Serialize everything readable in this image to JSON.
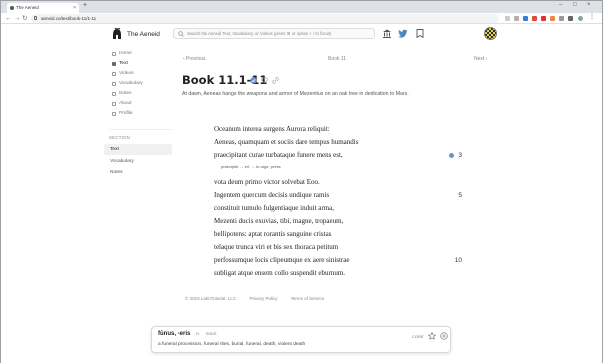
{
  "browser": {
    "tab_title": "The Aeneid",
    "tab_close": "×",
    "new_tab": "+",
    "window_controls": [
      "–",
      "□",
      "×"
    ],
    "back": "←",
    "forward": "→",
    "reload": "↻",
    "url": "aeneid.co/text/book-11/1-11"
  },
  "site": {
    "brand": "The Aeneid",
    "search_placeholder": "Search the Aeneid Text, Vocabulary, or Videos (press ⌘ or option + / to focus)"
  },
  "sidebar": {
    "items": [
      {
        "label": "Home",
        "icon": "home-icon"
      },
      {
        "label": "Text",
        "icon": "book-icon",
        "active": true
      },
      {
        "label": "Videos",
        "icon": "video-icon"
      },
      {
        "label": "Vocabulary",
        "icon": "list-icon"
      },
      {
        "label": "Notes",
        "icon": "note-icon"
      },
      {
        "label": "About",
        "icon": "info-icon"
      },
      {
        "label": "Profile",
        "icon": "user-icon"
      }
    ],
    "section_label": "SECTION",
    "section_items": [
      {
        "label": "Text",
        "active": true
      },
      {
        "label": "Vocabulary"
      },
      {
        "label": "Notes"
      }
    ]
  },
  "nav": {
    "previous": "‹  Previous",
    "current": "Book 11",
    "next": "Next  ›"
  },
  "page": {
    "title": "Book 11.1-11",
    "subtitle": "At dawn, Aeneas hangs the weapons and armor of Mezentius on an oak tree in dedication to Mars."
  },
  "lines": [
    {
      "text": "Oceanum interea surgens Aurora reliquit:",
      "num": ""
    },
    {
      "text": "Aeneas, quamquam et sociis dare tempus humandis",
      "num": ""
    },
    {
      "text": "praecipitant curae turbataque funere mens est,",
      "num": "3",
      "marker": true
    },
    {
      "gloss": "praecipitō → inf. → to urge, press"
    },
    {
      "text": "vota deum primo victor solvebat Eoo.",
      "num": ""
    },
    {
      "text": "Ingentem quercum decisis undique ramis",
      "num": "5"
    },
    {
      "text": "constituit tumulo fulgentiaque induit arma,",
      "num": ""
    },
    {
      "text": "Mezenti ducis exuvias, tibi, magne, tropaeum,",
      "num": ""
    },
    {
      "text": "bellipotens: aptat rorantis sanguine cristas",
      "num": ""
    },
    {
      "text": "telaque trunca viri et bis sex thoraca petitum",
      "num": ""
    },
    {
      "text": "perfossumque locis clipeumque ex aere sinistrae",
      "num": "10"
    },
    {
      "text": "subligat atque ensem collo suspendit eburnum.",
      "num": ""
    }
  ],
  "footer": {
    "copyright": "© 2023 LatinTutorial, LLC",
    "privacy": "Privacy Policy",
    "terms": "Terms of Service"
  },
  "vocab_card": {
    "headword": "fūnus, -eris",
    "gender": "n.",
    "pos": "noun",
    "definition": "a funeral procession, funeral rites, burial, funeral, death, violent death",
    "tag": "CORE"
  },
  "colors": {
    "accent": "#6d8fd6",
    "active_bg": "#f0f0f0"
  }
}
